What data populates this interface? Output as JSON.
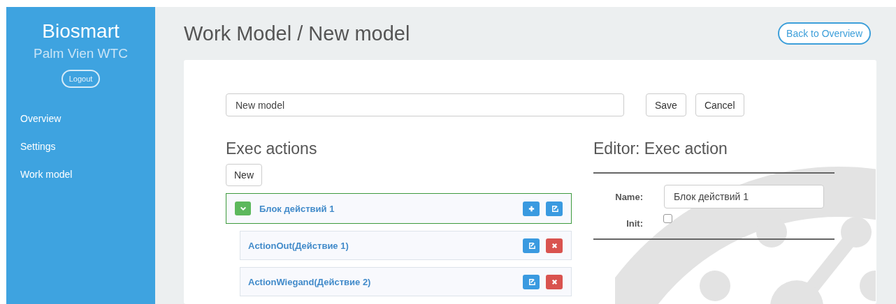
{
  "sidebar": {
    "brand": "Biosmart",
    "subtitle": "Palm Vien WTC",
    "logout": "Logout",
    "items": [
      {
        "label": "Overview"
      },
      {
        "label": "Settings"
      },
      {
        "label": "Work model"
      }
    ]
  },
  "header": {
    "title": "Work Model / New model",
    "back_button": "Back to Overview"
  },
  "model_form": {
    "name_value": "New model",
    "save": "Save",
    "cancel": "Cancel"
  },
  "exec_actions": {
    "title": "Exec actions",
    "new_button": "New",
    "items": [
      {
        "label": "Блок действий 1",
        "kind": "block",
        "expanded": true,
        "selected": true,
        "buttons": [
          {
            "kind": "add"
          },
          {
            "kind": "edit"
          }
        ],
        "children": [
          {
            "label": "ActionOut(Действие 1)",
            "kind": "action",
            "selected": false,
            "buttons": [
              {
                "kind": "edit"
              },
              {
                "kind": "delete"
              }
            ]
          },
          {
            "label": "ActionWiegand(Действие 2)",
            "kind": "action",
            "selected": false,
            "buttons": [
              {
                "kind": "edit"
              },
              {
                "kind": "delete"
              }
            ]
          }
        ]
      }
    ]
  },
  "editor": {
    "title": "Editor: Exec action",
    "name_label": "Name:",
    "name_value": "Блок действий 1",
    "init_label": "Init:",
    "init_checked": false
  }
}
